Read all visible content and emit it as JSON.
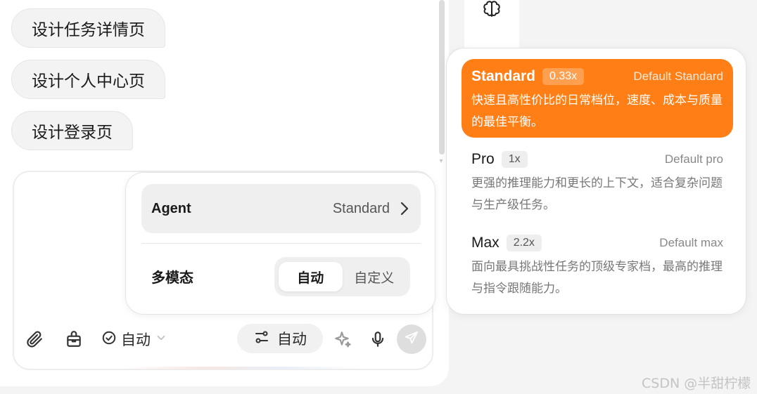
{
  "suggestions": [
    "设计任务详情页",
    "设计个人中心页",
    "设计登录页"
  ],
  "agent_popup": {
    "agent_label": "Agent",
    "agent_value": "Standard",
    "multimodal_label": "多模态",
    "modes": [
      "自动",
      "自定义"
    ],
    "active_mode": "自动"
  },
  "toolbar": {
    "icons": [
      "paperclip-icon",
      "toolbox-icon",
      "check-circle-icon",
      "chevron-down-icon",
      "sliders-icon",
      "sparkle-icon",
      "microphone-icon",
      "send-icon"
    ],
    "auto_select_label": "自动",
    "auto_pill_label": "自动"
  },
  "model_menu": {
    "items": [
      {
        "name": "Standard",
        "multiplier": "0.33x",
        "default_label": "Default Standard",
        "description": "快速且高性价比的日常档位，速度、成本与质量的最佳平衡。",
        "selected": true
      },
      {
        "name": "Pro",
        "multiplier": "1x",
        "default_label": "Default pro",
        "description": "更强的推理能力和更长的上下文，适合复杂问题与生产级任务。",
        "selected": false
      },
      {
        "name": "Max",
        "multiplier": "2.2x",
        "default_label": "Default max",
        "description": "面向最具挑战性任务的顶级专家档，最高的推理与指令跟随能力。",
        "selected": false
      }
    ]
  },
  "colors": {
    "accent": "#ff7f16",
    "panel_bg": "#ffffff",
    "page_bg": "#f4f4f4"
  },
  "watermark": "CSDN @半甜柠檬"
}
